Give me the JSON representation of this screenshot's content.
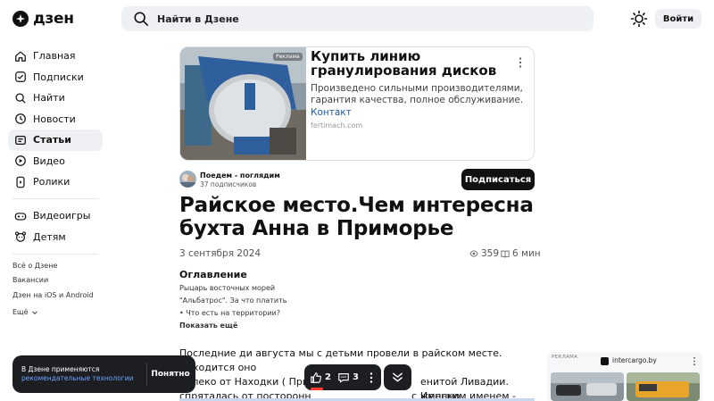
{
  "header": {
    "logo_text": "дзен",
    "search_placeholder": "Найти в Дзене",
    "login_label": "Войти"
  },
  "sidebar": {
    "items": [
      {
        "label": "Главная",
        "icon": "home-icon"
      },
      {
        "label": "Подписки",
        "icon": "subscriptions-icon"
      },
      {
        "label": "Найти",
        "icon": "search-icon"
      },
      {
        "label": "Новости",
        "icon": "news-icon"
      },
      {
        "label": "Статьи",
        "icon": "articles-icon",
        "active": true
      },
      {
        "label": "Видео",
        "icon": "video-icon"
      },
      {
        "label": "Ролики",
        "icon": "shorts-icon"
      },
      {
        "label": "Видеоигры",
        "icon": "gamepad-icon"
      },
      {
        "label": "Детям",
        "icon": "kids-icon"
      }
    ],
    "footer_links": [
      "Всё о Дзене",
      "Вакансии",
      "Дзен на iOS и Android",
      "Ещё"
    ]
  },
  "ad": {
    "badge": "Реклама",
    "title": "Купить линию гранулирования дисков",
    "description": "Произведено сильными производителями, гарантия качества, полное обслуживание.",
    "link": "Контакт",
    "domain": "fertimach.com"
  },
  "channel": {
    "name": "Поедем - поглядим",
    "subscribers": "37 подписчиков",
    "subscribe_label": "Подписаться"
  },
  "article": {
    "title": "Райское место.Чем интересна бухта Анна в Приморье",
    "date": "3 сентября 2024",
    "views": "359",
    "read_time": "6 мин",
    "toc_title": "Оглавление",
    "toc_items": [
      "Рыцарь восточных морей",
      "\"Альбатрос\". За что платить",
      "• Что есть на территории?"
    ],
    "toc_more": "Показать ещё",
    "text_lines": [
      "Последние ди августа мы с детьми провели в райском месте. Находится оно",
      "далеко от Находки ( Прим",
      "спряталась от посторонн"
    ],
    "text_tail": [
      "енитой Ливадии. Именно",
      "с женским именем - Анна."
    ]
  },
  "cookie": {
    "line1": "В Дзене применяются",
    "link": "рекомендательные технологии",
    "button": "Понятно"
  },
  "reactions": {
    "likes": "2",
    "comments": "3"
  },
  "right_ad": {
    "label": "РЕКЛАМА",
    "domain": "intercargo.by"
  },
  "colors": {
    "accent_dark": "#111111",
    "surface": "#eef0f3",
    "link_blue": "#1e5ba8",
    "toast_bg": "#1d1e22",
    "highlight_red": "#ff3b30"
  }
}
